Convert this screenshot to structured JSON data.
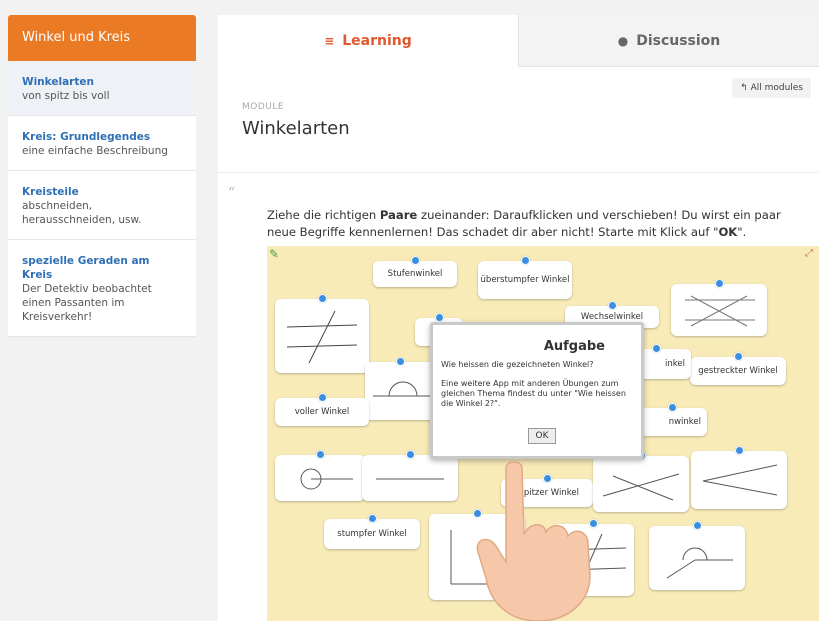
{
  "sidebar": {
    "header": "Winkel und Kreis",
    "items": [
      {
        "title": "Winkelarten",
        "subtitle": "von spitz bis voll"
      },
      {
        "title": "Kreis: Grundlegendes",
        "subtitle": "eine einfache Beschreibung"
      },
      {
        "title": "Kreisteile",
        "subtitle": "abschneiden,\nherausschneiden, usw."
      },
      {
        "title": "spezielle Geraden am Kreis",
        "subtitle": "Der Detektiv beobachtet einen Passanten im Kreisverkehr!"
      }
    ]
  },
  "tabs": {
    "learning": "Learning",
    "discussion": "Discussion"
  },
  "all_modules": "All modules",
  "module": {
    "label": "MODULE",
    "title": "Winkelarten"
  },
  "instruction": {
    "part1": "Ziehe die richtigen ",
    "bold1": "Paare",
    "part2": " zueinander: Daraufklicken und verschieben! Du wirst ein paar neue Begriffe kennenlernen! Das schadet dir aber nicht! Starte mit Klick auf \"",
    "bold2": "OK",
    "part3": "\"."
  },
  "cards": {
    "stufenwinkel": "Stufenwinkel",
    "ueberstumpfer": "überstumpfer Winkel",
    "wechselwinkel": "Wechselwinkel",
    "gestreckter": "gestreckter Winkel",
    "voller": "voller Winkel",
    "nebenwinkel": "nwinkel",
    "scheitelwinkel": "inkel",
    "spitzer": "spitzer Winkel",
    "stumpfer": "stumpfer Winkel"
  },
  "dialog": {
    "title": "Aufgabe",
    "question": "Wie heissen die gezeichneten Winkel?",
    "text": "Eine weitere App mit anderen Übungen zum gleichen Thema findest du unter \"Wie heissen die Winkel 2?\".",
    "ok": "OK"
  },
  "colors": {
    "accent": "#ea7a24",
    "tab_active": "#e2572c",
    "link": "#2f6fb3",
    "board": "#f8ebb8",
    "pin": "#3a8fe0"
  }
}
